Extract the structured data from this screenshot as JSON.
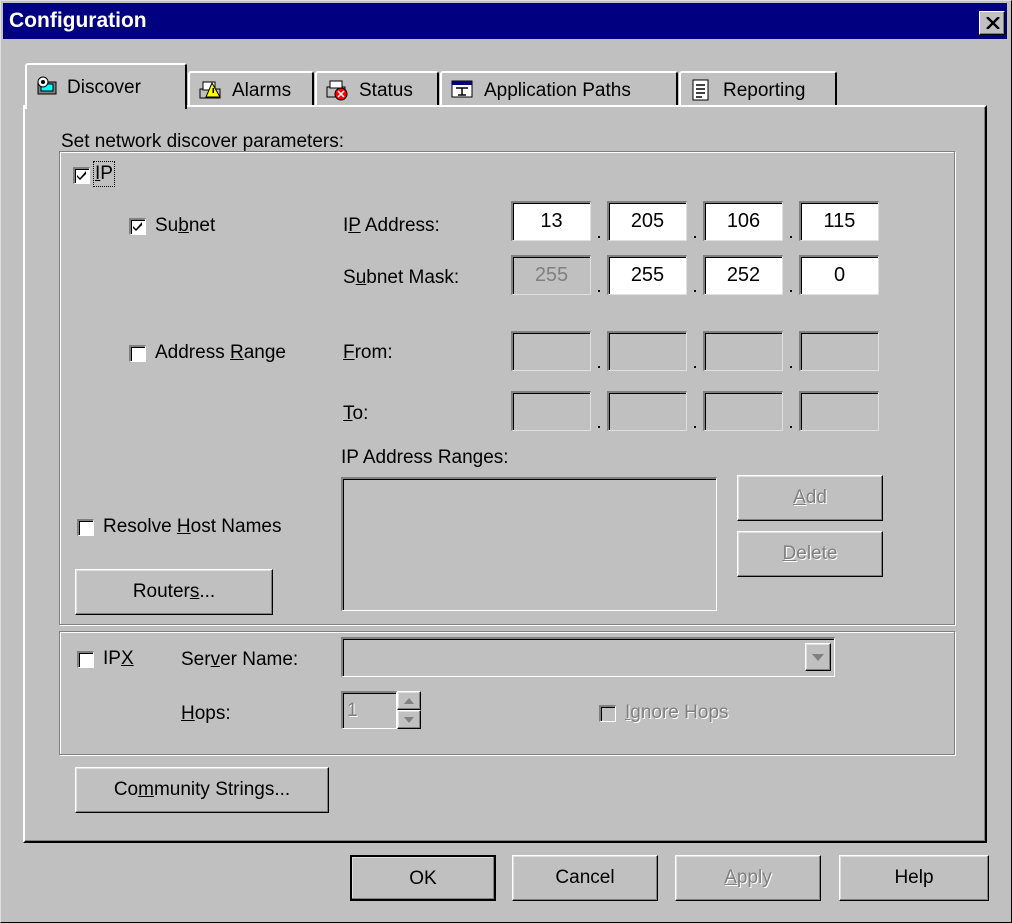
{
  "window": {
    "title": "Configuration"
  },
  "tabs": [
    {
      "label": "Discover",
      "icon": "discover-icon",
      "active": true
    },
    {
      "label": "Alarms",
      "icon": "alarm-icon"
    },
    {
      "label": "Status",
      "icon": "status-icon"
    },
    {
      "label": "Application Paths",
      "icon": "application-paths-icon"
    },
    {
      "label": "Reporting",
      "icon": "report-icon"
    }
  ],
  "discover": {
    "heading": "Set network discover parameters:",
    "ip": {
      "label_pre": "",
      "label_u": "I",
      "label_post": "P",
      "checked": true,
      "subnet": {
        "label_pre": "Su",
        "label_u": "b",
        "label_post": "net",
        "checked": true
      },
      "ip_address": {
        "label_pre": "I",
        "label_u": "P",
        "label_post": " Address:",
        "octets": [
          "13",
          "205",
          "106",
          "115"
        ]
      },
      "subnet_mask": {
        "label_pre": "S",
        "label_u": "u",
        "label_post": "bnet Mask:",
        "octets": [
          "255",
          "255",
          "252",
          "0"
        ]
      },
      "address_range": {
        "label_pre": "Address ",
        "label_u": "R",
        "label_post": "ange",
        "checked": false
      },
      "from": {
        "label_pre": "",
        "label_u": "F",
        "label_post": "rom:",
        "octets": [
          "",
          "",
          "",
          ""
        ]
      },
      "to": {
        "label_pre": "",
        "label_u": "T",
        "label_post": "o:",
        "octets": [
          "",
          "",
          "",
          ""
        ]
      },
      "ranges_label": "IP Address Ranges:",
      "ranges": [],
      "resolve_host_names": {
        "label_pre": "Resolve ",
        "label_u": "H",
        "label_post": "ost Names",
        "checked": false
      },
      "add": {
        "label_pre": "",
        "label_u": "A",
        "label_post": "dd"
      },
      "delete": {
        "label_pre": "",
        "label_u": "D",
        "label_post": "elete"
      },
      "routers": {
        "label_pre": "Router",
        "label_u": "s",
        "label_post": "..."
      }
    },
    "ipx": {
      "label_pre": "IP",
      "label_u": "X",
      "label_post": "",
      "checked": false,
      "server_name": {
        "label_pre": "Ser",
        "label_u": "v",
        "label_post": "er Name:",
        "value": ""
      },
      "hops": {
        "label_pre": "",
        "label_u": "H",
        "label_post": "ops:",
        "value": "1"
      },
      "ignore_hops": {
        "label_pre": "",
        "label_u": "I",
        "label_post": "gnore Hops",
        "checked": false
      }
    },
    "community": {
      "label_pre": "Co",
      "label_u": "m",
      "label_post": "munity Strings..."
    }
  },
  "footer": {
    "ok": "OK",
    "cancel": "Cancel",
    "apply": {
      "label_pre": "",
      "label_u": "A",
      "label_post": "pply"
    },
    "help": "Help"
  }
}
